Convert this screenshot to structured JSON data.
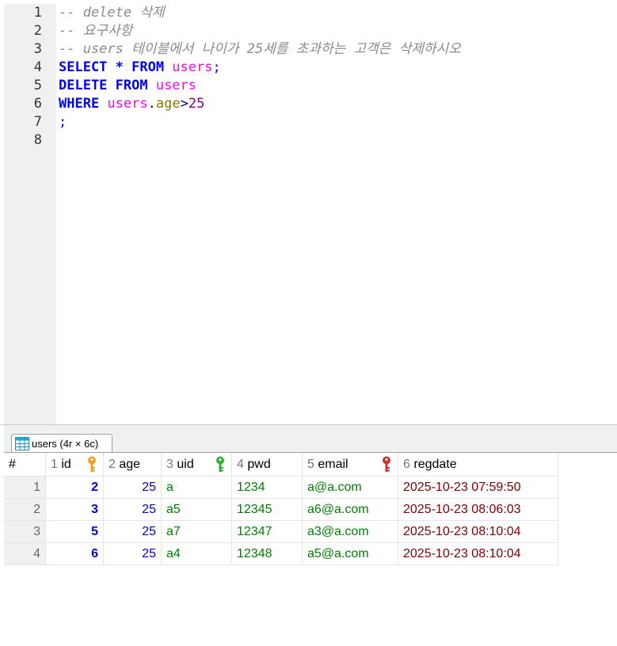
{
  "editor": {
    "lines": [
      {
        "no": "1",
        "tokens": [
          {
            "t": "-- delete 삭제",
            "c": "comment"
          }
        ]
      },
      {
        "no": "2",
        "tokens": [
          {
            "t": "-- 요구사항",
            "c": "comment"
          }
        ]
      },
      {
        "no": "3",
        "tokens": [
          {
            "t": "-- users 테이블에서 나이가 25세를 초과하는 고객은 삭제하시오",
            "c": "comment"
          }
        ]
      },
      {
        "no": "4",
        "tokens": [
          {
            "t": "SELECT * FROM ",
            "c": "kw"
          },
          {
            "t": "users",
            "c": "tbl"
          },
          {
            "t": ";",
            "c": "punct"
          }
        ]
      },
      {
        "no": "5",
        "tokens": [
          {
            "t": "DELETE FROM ",
            "c": "kw"
          },
          {
            "t": "users",
            "c": "tbl"
          }
        ]
      },
      {
        "no": "6",
        "tokens": [
          {
            "t": "WHERE ",
            "c": "kw"
          },
          {
            "t": "users",
            "c": "tbl"
          },
          {
            "t": ".",
            "c": "op"
          },
          {
            "t": "age",
            "c": "col"
          },
          {
            "t": ">",
            "c": "op"
          },
          {
            "t": "25",
            "c": "num"
          }
        ]
      },
      {
        "no": "7",
        "tokens": [
          {
            "t": ";",
            "c": "punct"
          }
        ]
      },
      {
        "no": "8",
        "tokens": []
      }
    ]
  },
  "result_tab": {
    "label": "users (4r × 6c)",
    "icon": "table-grid-icon"
  },
  "grid": {
    "rownum_header": "#",
    "columns": [
      {
        "num": "1",
        "name": "id",
        "key": "primary-key-icon",
        "key_color": "#f0a020"
      },
      {
        "num": "2",
        "name": "age",
        "key": null
      },
      {
        "num": "3",
        "name": "uid",
        "key": "unique-key-icon",
        "key_color": "#30b030"
      },
      {
        "num": "4",
        "name": "pwd",
        "key": null
      },
      {
        "num": "5",
        "name": "email",
        "key": "foreign-key-icon",
        "key_color": "#d03030"
      },
      {
        "num": "6",
        "name": "regdate",
        "key": null
      }
    ],
    "rows": [
      {
        "n": "1",
        "id": "2",
        "age": "25",
        "uid": "a",
        "pwd": "1234",
        "email": "a@a.com",
        "regdate": "2025-10-23 07:59:50"
      },
      {
        "n": "2",
        "id": "3",
        "age": "25",
        "uid": "a5",
        "pwd": "12345",
        "email": "a6@a.com",
        "regdate": "2025-10-23 08:06:03"
      },
      {
        "n": "3",
        "id": "5",
        "age": "25",
        "uid": "a7",
        "pwd": "12347",
        "email": "a3@a.com",
        "regdate": "2025-10-23 08:10:04"
      },
      {
        "n": "4",
        "id": "6",
        "age": "25",
        "uid": "a4",
        "pwd": "12348",
        "email": "a5@a.com",
        "regdate": "2025-10-23 08:10:04"
      }
    ]
  }
}
